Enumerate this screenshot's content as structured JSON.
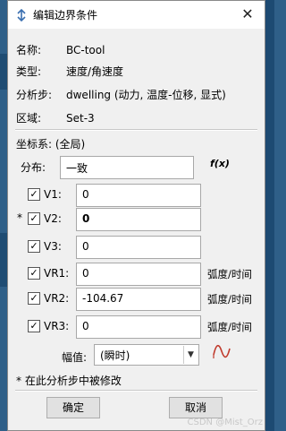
{
  "dialog": {
    "title": "编辑边界条件",
    "close_symbol": "✕"
  },
  "info": [
    {
      "label": "名称:",
      "value": "BC-tool"
    },
    {
      "label": "类型:",
      "value": "速度/角速度"
    },
    {
      "label": "分析步:",
      "value": "dwelling (动力, 温度-位移, 显式)"
    },
    {
      "label": "区域:",
      "value": "Set-3"
    }
  ],
  "coord_system": "坐标系: (全局)",
  "distribution": {
    "label": "分布:",
    "value": "一致",
    "fx_icon": "f(x)"
  },
  "components": [
    {
      "star": "",
      "checked": true,
      "label": "V1:",
      "value": "0",
      "unit": "",
      "bold": false
    },
    {
      "star": "*",
      "checked": true,
      "label": "V2:",
      "value": "0",
      "unit": "",
      "bold": true
    },
    {
      "star": "",
      "checked": true,
      "label": "V3:",
      "value": "0",
      "unit": "",
      "bold": false
    },
    {
      "star": "",
      "checked": true,
      "label": "VR1:",
      "value": "0",
      "unit": "弧度/时间",
      "bold": false
    },
    {
      "star": "",
      "checked": true,
      "label": "VR2:",
      "value": "-104.67",
      "unit": "弧度/时间",
      "bold": false
    },
    {
      "star": "",
      "checked": true,
      "label": "VR3:",
      "value": "0",
      "unit": "弧度/时间",
      "bold": false
    }
  ],
  "amplitude": {
    "label": "幅值:",
    "selected": "(瞬时)",
    "arrow": "▼"
  },
  "footnote": "* 在此分析步中被修改",
  "buttons": {
    "ok": "确定",
    "cancel": "取消"
  },
  "watermark": "CSDN @Mist_Orz",
  "colors": {
    "background": "#2f5f88",
    "dialog_bg": "#f0f0f0",
    "amp_icon": "#c0392b"
  }
}
